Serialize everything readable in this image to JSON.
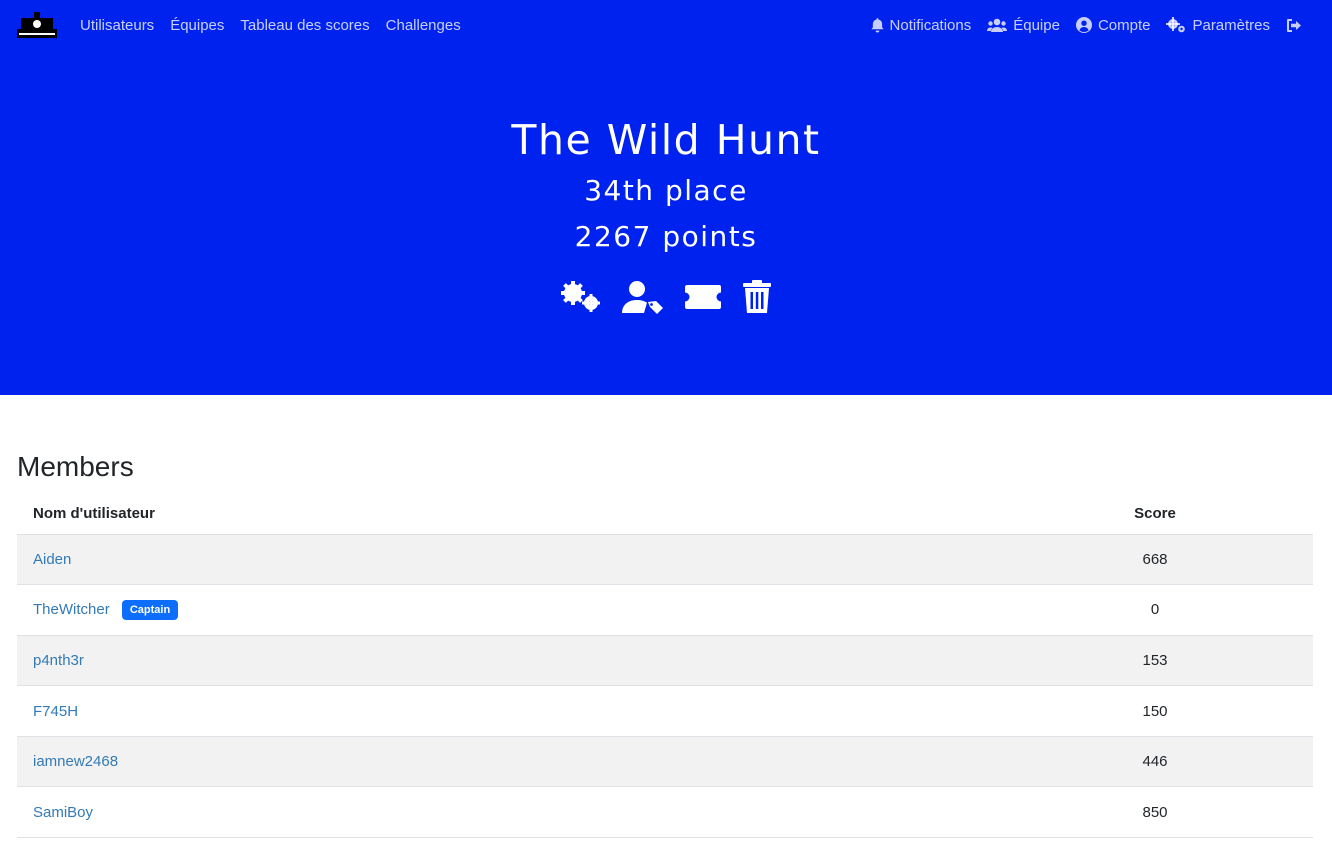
{
  "nav": {
    "left": [
      {
        "label": "Utilisateurs"
      },
      {
        "label": "Équipes"
      },
      {
        "label": "Tableau des scores"
      },
      {
        "label": "Challenges"
      }
    ],
    "right": [
      {
        "label": "Notifications",
        "icon": "bell-icon"
      },
      {
        "label": "Équipe",
        "icon": "users-icon"
      },
      {
        "label": "Compte",
        "icon": "user-circle-icon"
      },
      {
        "label": "Paramètres",
        "icon": "gears-icon"
      },
      {
        "label": "",
        "icon": "logout-icon"
      }
    ]
  },
  "team": {
    "name": "The Wild Hunt",
    "place": "34th place",
    "points": "2267 points",
    "actions": [
      "settings-icon",
      "user-tag-icon",
      "ticket-icon",
      "trash-icon"
    ]
  },
  "members": {
    "title": "Members",
    "columns": {
      "username": "Nom d'utilisateur",
      "score": "Score"
    },
    "rows": [
      {
        "name": "Aiden",
        "score": "668",
        "badge": ""
      },
      {
        "name": "TheWitcher",
        "score": "0",
        "badge": "Captain"
      },
      {
        "name": "p4nth3r",
        "score": "153",
        "badge": ""
      },
      {
        "name": "F745H",
        "score": "150",
        "badge": ""
      },
      {
        "name": "iamnew2468",
        "score": "446",
        "badge": ""
      },
      {
        "name": "SamiBoy",
        "score": "850",
        "badge": ""
      }
    ]
  },
  "colors": {
    "brand": "#0022ee",
    "link": "#337ab7",
    "badge": "#0d6efd"
  }
}
